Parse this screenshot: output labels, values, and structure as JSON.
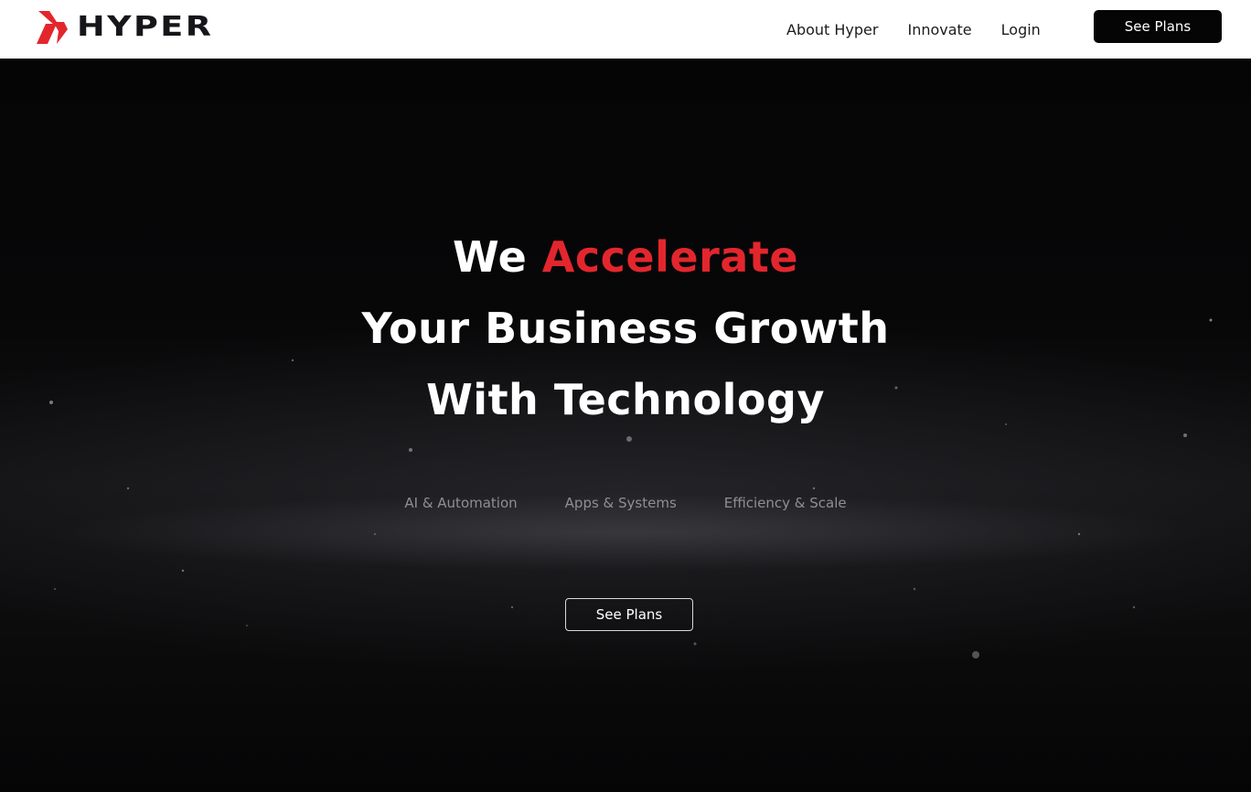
{
  "brand": {
    "name": "HYPER",
    "logo_icon": "hyper-x-icon",
    "accent_color": "#e3262d"
  },
  "nav": {
    "links": [
      "About Hyper",
      "Innovate",
      "Login"
    ],
    "cta_label": "See Plans"
  },
  "hero": {
    "headline_line1_prefix": "We",
    "headline_line1_accent": "Accelerate",
    "headline_line2": "Your Business Growth",
    "headline_line3": "With Technology",
    "features": [
      "AI & Automation",
      "Apps & Systems",
      "Efficiency & Scale"
    ],
    "cta_label": "See Plans"
  },
  "colors": {
    "nav_bg": "#ffffff",
    "hero_bg": "#050506",
    "text_light": "#ffffff",
    "feature_text": "#8e8e94"
  }
}
